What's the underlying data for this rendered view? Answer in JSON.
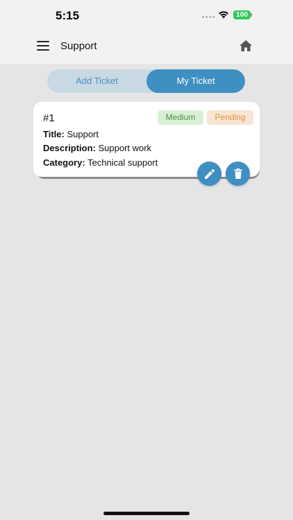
{
  "status_bar": {
    "time": "5:15",
    "battery": "100"
  },
  "app_bar": {
    "title": "Support"
  },
  "tabs": [
    {
      "label": "Add Ticket",
      "active": false
    },
    {
      "label": "My Ticket",
      "active": true
    }
  ],
  "ticket": {
    "id": "#1",
    "priority": "Medium",
    "status": "Pending",
    "title_label": "Title:",
    "title": "Support",
    "description_label": "Description:",
    "description": "Support work",
    "category_label": "Category:",
    "category": "Technical support"
  },
  "icons": {
    "menu": "menu-icon",
    "home": "home-icon",
    "edit": "pencil-icon",
    "delete": "trash-icon",
    "wifi": "wifi-icon"
  },
  "colors": {
    "accent": "#3f8fc2",
    "tab_inactive_bg": "#c8d9e4",
    "priority_bg": "#d8efd5",
    "priority_text": "#4c8f47",
    "status_bg": "#f7e4d2",
    "status_text": "#e3963a",
    "battery": "#34c759"
  }
}
